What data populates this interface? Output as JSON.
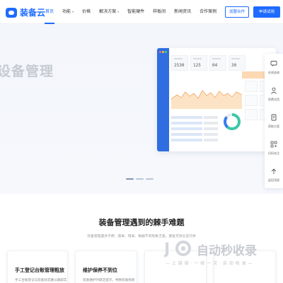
{
  "brand": {
    "name": "装备云",
    "logo_color": "#1e6bff"
  },
  "nav": {
    "items": [
      {
        "label": "首页",
        "active": true,
        "dropdown": false
      },
      {
        "label": "功能",
        "active": false,
        "dropdown": true
      },
      {
        "label": "价格",
        "active": false,
        "dropdown": false
      },
      {
        "label": "解决方案",
        "active": false,
        "dropdown": true
      },
      {
        "label": "智能硬件",
        "active": false,
        "dropdown": false
      },
      {
        "label": "样板间",
        "active": false,
        "dropdown": false
      },
      {
        "label": "新闻资讯",
        "active": false,
        "dropdown": false
      },
      {
        "label": "合作案例",
        "active": false,
        "dropdown": false
      }
    ],
    "caret_icon": "chevron-down-icon"
  },
  "header_buttons": {
    "join": "加盟合作",
    "trial": "申请试用"
  },
  "hero": {
    "title": "设备管理",
    "dashboard": {
      "stats": [
        "2530",
        "125",
        "04",
        "30"
      ]
    },
    "carousel": {
      "count": 3,
      "active_index": 0
    }
  },
  "float_bar": {
    "items": [
      {
        "label": "在线咨询",
        "icon": "chat-icon"
      },
      {
        "label": "免费试用",
        "icon": "user-icon"
      },
      {
        "label": "获取方案",
        "icon": "document-icon"
      },
      {
        "label": "扫码关注",
        "icon": "qrcode-icon"
      },
      {
        "label": "返回顶部",
        "icon": "arrow-up-icon"
      }
    ]
  },
  "problems": {
    "title": "装备管理遇到的棘手难题",
    "subtitle": "装备管理遇多不便、漏录、错录、数据不同现象泛滥，重复无效信息冗余",
    "cards": [
      {
        "title": "手工登记台账管理粗放",
        "desc": "手工台账登记与装备状态难以跟踪实"
      },
      {
        "title": "维护保养不到位",
        "desc": "装备维护时缺乏提示，导致装备损耗"
      },
      {
        "title": "",
        "desc": ""
      },
      {
        "title": "",
        "desc": ""
      }
    ]
  },
  "watermark": {
    "text": "自动秒收录",
    "sub": "— 上 链 接 · 一 统 一 次 · 自 动 收 录 —"
  },
  "colors": {
    "accent": "#1e6bff",
    "hero_bg": "#f3f6fb",
    "chart_orange": "#f5a55a",
    "donut_green": "#3cc9a6",
    "donut_blue": "#3a7cf0"
  }
}
